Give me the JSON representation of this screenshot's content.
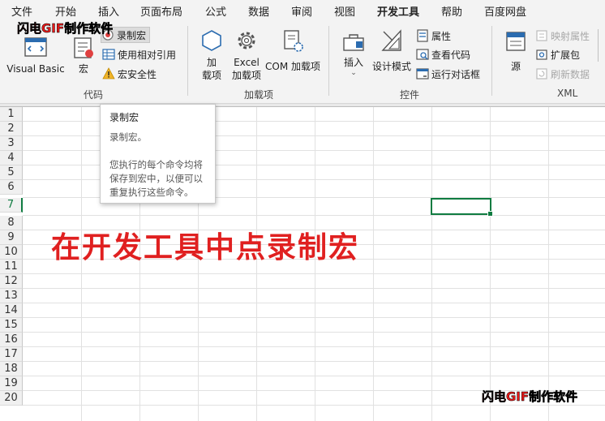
{
  "menu": {
    "tabs": [
      "文件",
      "开始",
      "插入",
      "页面布局",
      "公式",
      "数据",
      "审阅",
      "视图",
      "开发工具",
      "帮助",
      "百度网盘"
    ],
    "active": "开发工具"
  },
  "ribbon": {
    "code": {
      "label": "代码",
      "visual_basic": "Visual Basic",
      "macros": "宏",
      "record_macro": "录制宏",
      "relative_refs": "使用相对引用",
      "macro_security": "宏安全性"
    },
    "addins": {
      "label": "加载项",
      "addins_btn_line1": "加",
      "addins_btn_line2": "载项",
      "excel_addins_line1": "Excel",
      "excel_addins_line2": "加载项",
      "com_addins": "COM 加载项"
    },
    "controls": {
      "label": "控件",
      "insert": "插入",
      "design_mode": "设计模式",
      "properties": "属性",
      "view_code": "查看代码",
      "run_dialog": "运行对话框"
    },
    "xml": {
      "label": "XML",
      "source": "源",
      "map_properties": "映射属性",
      "expansion_packs": "扩展包",
      "refresh_data": "刷新数据"
    }
  },
  "tooltip": {
    "title": "录制宏",
    "line1": "录制宏。",
    "line2": "您执行的每个命令均将",
    "line3": "保存到宏中，以便可以",
    "line4": "重复执行这些命令。"
  },
  "sheet": {
    "rows": [
      "1",
      "2",
      "3",
      "4",
      "5",
      "6",
      "7",
      "8",
      "9",
      "10",
      "11",
      "12",
      "13",
      "14",
      "15",
      "16",
      "17",
      "18",
      "19",
      "20"
    ],
    "selected_row": "7"
  },
  "caption": "在开发工具中点录制宏",
  "watermark": {
    "part_a": "闪电GIF",
    "part_b": "制作软件"
  },
  "colors": {
    "accent": "#107c41",
    "caption": "#e02020",
    "ribbon_bg": "#f3f3f3"
  }
}
